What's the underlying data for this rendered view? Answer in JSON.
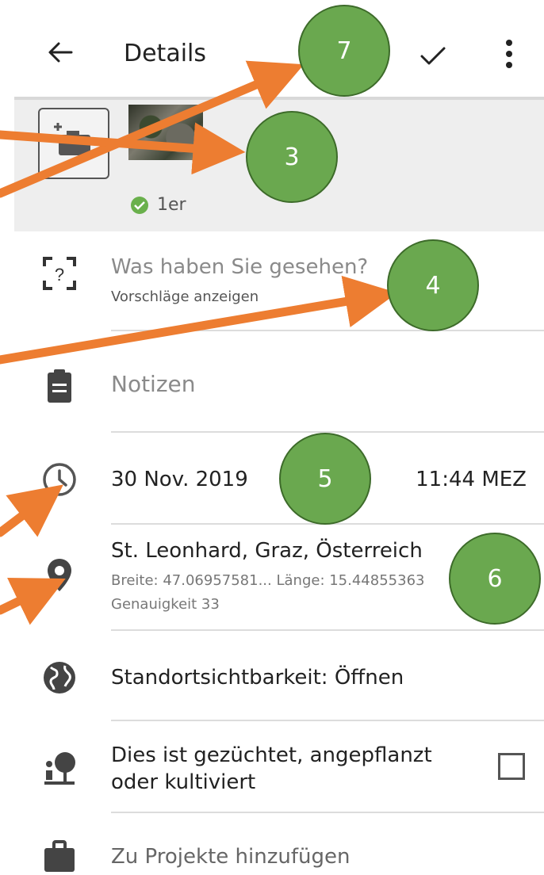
{
  "header": {
    "title": "Details"
  },
  "photos": {
    "status_label": "1er"
  },
  "species": {
    "placeholder": "Was haben Sie gesehen?",
    "suggestions": "Vorschläge anzeigen"
  },
  "notes": {
    "placeholder": "Notizen"
  },
  "datetime": {
    "date": "30 Nov. 2019",
    "time": "11:44 MEZ"
  },
  "location": {
    "name": "St. Leonhard, Graz, Österreich",
    "coords": "Breite: 47.06957581...  Länge: 15.44855363",
    "accuracy": "Genauigkeit 33"
  },
  "visibility": {
    "label": "Standortsichtbarkeit: Öffnen"
  },
  "cultivated": {
    "label": "Dies ist gezüchtet, angepflanzt oder kultiviert",
    "checked": false
  },
  "projects": {
    "label": "Zu Projekte hinzufügen"
  },
  "annotations": {
    "badges": [
      "7",
      "3",
      "4",
      "5",
      "6"
    ]
  },
  "colors": {
    "badge": "#6aa84f",
    "arrow": "#ed7d31",
    "accent_check": "#4caf50"
  }
}
